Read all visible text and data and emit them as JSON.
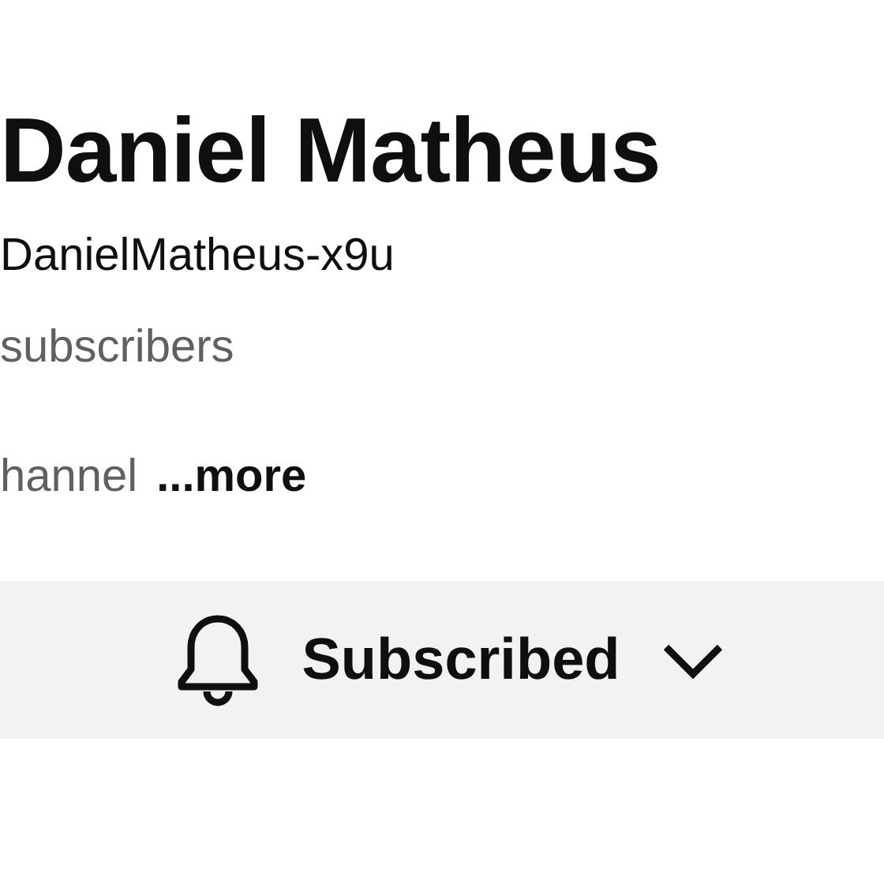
{
  "channel": {
    "name": "Daniel Matheus",
    "handle": "DanielMatheus-x9u",
    "subscribers": "subscribers",
    "description": "hannel",
    "more_link": "...more"
  },
  "subscribe_button": {
    "label": "Subscribed",
    "subscribed": true
  }
}
